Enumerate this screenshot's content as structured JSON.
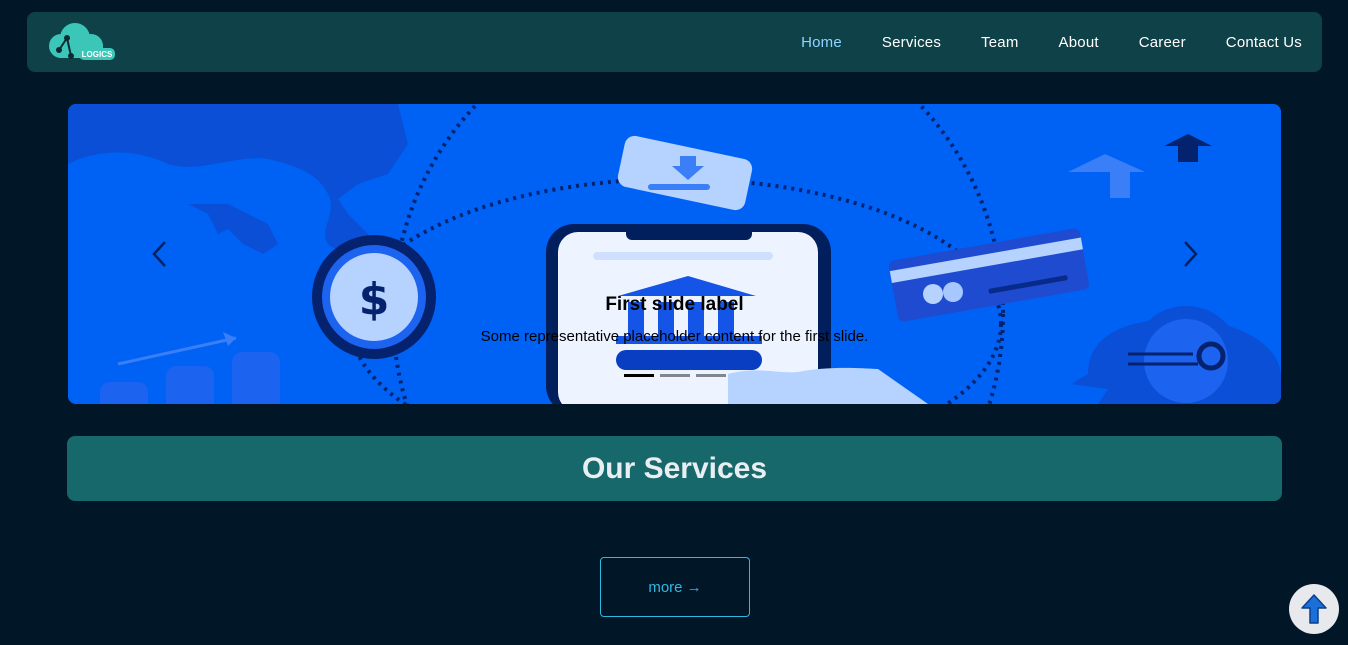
{
  "logo": {
    "icon": "cloud-logo-icon",
    "text": "LOGICS"
  },
  "nav": {
    "items": [
      {
        "label": "Home",
        "active": true
      },
      {
        "label": "Services",
        "active": false
      },
      {
        "label": "Team",
        "active": false
      },
      {
        "label": "About",
        "active": false
      },
      {
        "label": "Career",
        "active": false
      },
      {
        "label": "Contact Us",
        "active": false
      }
    ]
  },
  "carousel": {
    "caption_title": "First slide label",
    "caption_text": "Some representative placeholder content for the first slide.",
    "indicators": 3,
    "active_index": 0,
    "prev_icon": "chevron-left-icon",
    "next_icon": "chevron-right-icon"
  },
  "services": {
    "title": "Our Services"
  },
  "more_button": {
    "label": "more →"
  },
  "scroll_top": {
    "icon": "arrow-up-icon"
  },
  "colors": {
    "background": "#011627",
    "navbar": "#0e4148",
    "active_link": "#8fd4ff",
    "slide_blue": "#0062f5",
    "services_banner": "#17686a",
    "accent": "#30b8e0"
  }
}
